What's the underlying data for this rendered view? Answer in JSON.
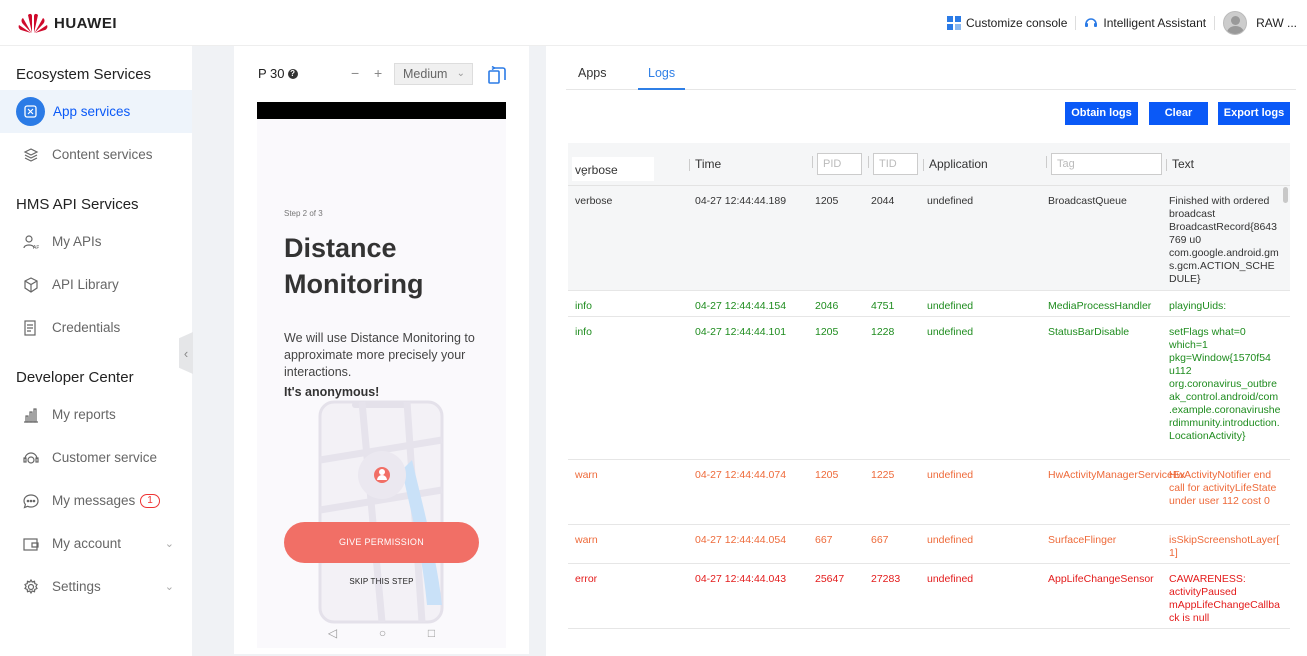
{
  "header": {
    "brand": "HUAWEI",
    "customize_console": "Customize console",
    "intelligent_assistant": "Intelligent Assistant",
    "user_name": "RAW ..."
  },
  "sidebar": {
    "sections": [
      {
        "title": "Ecosystem Services",
        "items": [
          {
            "label": "App services",
            "icon": "app-services-icon",
            "active": true
          },
          {
            "label": "Content services",
            "icon": "layers-icon"
          }
        ]
      },
      {
        "title": "HMS API Services",
        "items": [
          {
            "label": "My APIs",
            "icon": "api-user-icon"
          },
          {
            "label": "API Library",
            "icon": "cube-icon"
          },
          {
            "label": "Credentials",
            "icon": "credentials-icon"
          }
        ]
      },
      {
        "title": "Developer Center",
        "items": [
          {
            "label": "My reports",
            "icon": "bar-chart-icon"
          },
          {
            "label": "Customer service",
            "icon": "headset-icon"
          },
          {
            "label": "My messages",
            "icon": "message-icon",
            "badge": "1"
          },
          {
            "label": "My account",
            "icon": "wallet-icon",
            "expandable": true
          },
          {
            "label": "Settings",
            "icon": "gear-icon",
            "expandable": true
          }
        ]
      }
    ]
  },
  "device": {
    "name": "P 30",
    "zoom_minus": "−",
    "zoom_plus": "+",
    "size": "Medium",
    "screen": {
      "step": "Step 2 of 3",
      "title": "Distance Monitoring",
      "description": "We will use Distance Monitoring to approximate more precisely your interactions.",
      "anonymous": "It's anonymous!",
      "primary_button": "GIVE PERMISSION",
      "secondary_button": "SKIP THIS STEP",
      "nav": [
        "◁",
        "○",
        "□"
      ]
    }
  },
  "logs": {
    "tabs": [
      "Apps",
      "Logs"
    ],
    "active_tab": "Logs",
    "buttons": {
      "obtain": "Obtain logs",
      "clear": "Clear",
      "export": "Export logs"
    },
    "columns": {
      "level": "verbose",
      "time": "Time",
      "pid_placeholder": "PID",
      "tid_placeholder": "TID",
      "application": "Application",
      "tag_placeholder": "Tag",
      "text": "Text"
    },
    "rows": [
      {
        "level": "verbose",
        "time": "04-27 12:44:44.189",
        "pid": "1205",
        "tid": "2044",
        "app": "undefined",
        "tag": "BroadcastQueue",
        "text": "Finished with ordered broadcast BroadcastRecord{8643769 u0 com.google.android.gms.gcm.ACTION_SCHEDULE}"
      },
      {
        "level": "info",
        "time": "04-27 12:44:44.154",
        "pid": "2046",
        "tid": "4751",
        "app": "undefined",
        "tag": "MediaProcessHandler",
        "text": "playingUids:"
      },
      {
        "level": "info",
        "time": "04-27 12:44:44.101",
        "pid": "1205",
        "tid": "1228",
        "app": "undefined",
        "tag": "StatusBarDisable",
        "text": "setFlags what=0 which=1 pkg=Window{1570f54 u112 org.coronavirus_outbreak_control.android/com.example.coronavirusherdimmunity.introduction.LocationActivity}"
      },
      {
        "level": "warn",
        "time": "04-27 12:44:44.074",
        "pid": "1205",
        "tid": "1225",
        "app": "undefined",
        "tag": "HwActivityManagerServiceEx",
        "text": "HwActivityNotifier end call for activityLifeState under user 112 cost 0"
      },
      {
        "level": "warn",
        "time": "04-27 12:44:44.054",
        "pid": "667",
        "tid": "667",
        "app": "undefined",
        "tag": "SurfaceFlinger",
        "text": "isSkipScreenshotLayer[1]"
      },
      {
        "level": "error",
        "time": "04-27 12:44:44.043",
        "pid": "25647",
        "tid": "27283",
        "app": "undefined",
        "tag": "AppLifeChangeSensor",
        "text": "CAWARENESS: activityPaused mAppLifeChangeCallback is null"
      }
    ]
  },
  "colors": {
    "accent": "#0a59f7",
    "info": "#1e8c1e",
    "warn": "#ee6a3a",
    "error": "#e31b1b",
    "primary_cta": "#f16f66",
    "brand": "#cf0a2c"
  }
}
